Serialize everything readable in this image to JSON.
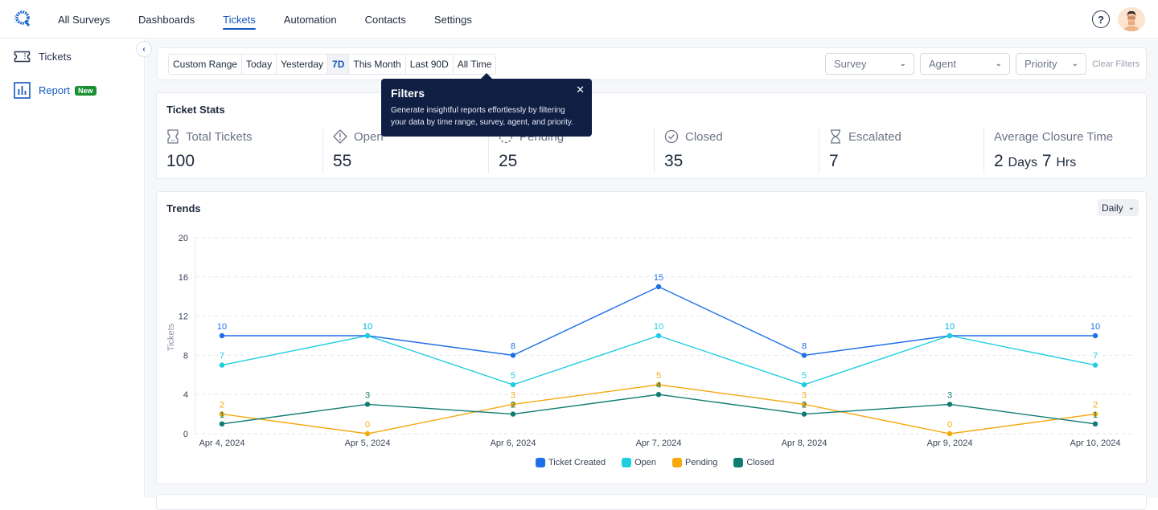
{
  "nav": {
    "items": [
      {
        "label": "All Surveys",
        "active": false
      },
      {
        "label": "Dashboards",
        "active": false
      },
      {
        "label": "Tickets",
        "active": true
      },
      {
        "label": "Automation",
        "active": false
      },
      {
        "label": "Contacts",
        "active": false
      },
      {
        "label": "Settings",
        "active": false
      }
    ],
    "help_icon": "?"
  },
  "sidebar": {
    "items": [
      {
        "label": "Tickets",
        "icon": "ticket-icon",
        "active": false
      },
      {
        "label": "Report",
        "icon": "bar-chart-icon",
        "active": true,
        "badge": "New"
      }
    ],
    "collapse_icon": "‹"
  },
  "filters": {
    "ranges": [
      "Custom Range",
      "Today",
      "Yesterday",
      "7D",
      "This Month",
      "Last 90D",
      "All Time"
    ],
    "active_range": "7D",
    "dropdowns": [
      {
        "placeholder": "Survey"
      },
      {
        "placeholder": "Agent"
      },
      {
        "placeholder": "Priority"
      }
    ],
    "clear_label": "Clear Filters"
  },
  "tooltip": {
    "title": "Filters",
    "body": "Generate insightful reports effortlessly by filtering your data by time range, survey, agent, and priority.",
    "close": "✕"
  },
  "stats": {
    "title": "Ticket Stats",
    "items": [
      {
        "label": "Total Tickets",
        "value": "100",
        "icon": "ticket-icon"
      },
      {
        "label": "Open",
        "value": "55",
        "icon": "alert-icon"
      },
      {
        "label": "Pending",
        "value": "25",
        "icon": "pending-icon"
      },
      {
        "label": "Closed",
        "value": "35",
        "icon": "check-circle-icon"
      },
      {
        "label": "Escalated",
        "value": "7",
        "icon": "hourglass-icon"
      }
    ],
    "avg_closure": {
      "label": "Average Closure Time",
      "days": "2",
      "days_unit": "Days",
      "hours": "7",
      "hours_unit": "Hrs"
    }
  },
  "trends": {
    "title": "Trends",
    "granularity": "Daily"
  },
  "chart_data": {
    "type": "line",
    "title": "Trends",
    "xlabel": "",
    "ylabel": "Tickets",
    "ylim": [
      0,
      20
    ],
    "yticks": [
      0,
      4,
      8,
      12,
      16,
      20
    ],
    "grid": true,
    "legend": "bottom-center",
    "categories": [
      "Apr 4, 2024",
      "Apr 5, 2024",
      "Apr 6, 2024",
      "Apr 7, 2024",
      "Apr 8, 2024",
      "Apr 9, 2024",
      "Apr 10, 2024"
    ],
    "series": [
      {
        "name": "Ticket Created",
        "color": "#1f6fe8",
        "values": [
          10,
          10,
          8,
          15,
          8,
          10,
          10
        ]
      },
      {
        "name": "Open",
        "color": "#1fcde0",
        "values": [
          7,
          10,
          5,
          10,
          5,
          10,
          7
        ]
      },
      {
        "name": "Pending",
        "color": "#f5a90f",
        "values": [
          2,
          0,
          3,
          5,
          3,
          0,
          2
        ]
      },
      {
        "name": "Closed",
        "color": "#0f7c72",
        "values": [
          1,
          3,
          2,
          4,
          2,
          3,
          1
        ]
      }
    ]
  }
}
